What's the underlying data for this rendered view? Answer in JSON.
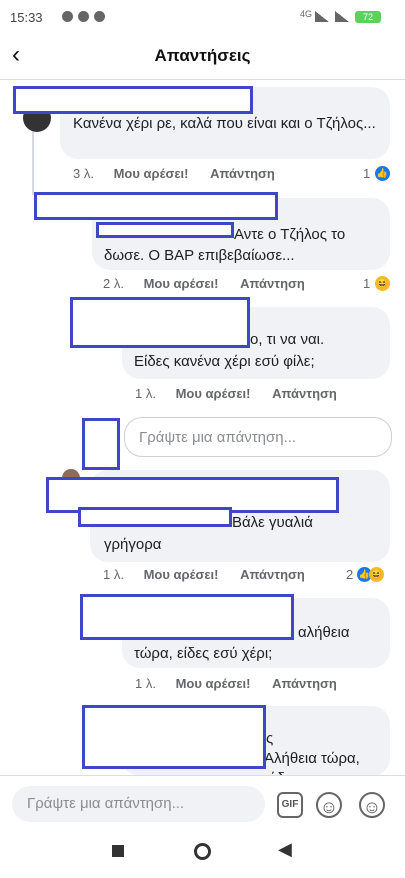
{
  "status": {
    "time": "15:33",
    "signal_text": "4G",
    "battery": "72"
  },
  "header": {
    "title": "Απαντήσεις",
    "back_icon": "back-arrow-icon"
  },
  "comments": [
    {
      "text": "Κανένα χέρι ρε, καλά που είναι και ο Τζήλος...",
      "time": "3 λ.",
      "like": "Μου αρέσει!",
      "reply": "Απάντηση",
      "reactions": "1"
    },
    {
      "text": "Αντε ο Τζήλος το δωσε. Ο ΒΑΡ επιβεβαίωσε...",
      "time": "2 λ.",
      "like": "Μου αρέσει!",
      "reply": "Απάντηση",
      "reactions": "1"
    },
    {
      "text": "ο, τι να ναι.",
      "text2": "Είδες κανένα χέρι εσύ φίλε;",
      "time": "1 λ.",
      "like": "Μου αρέσει!",
      "reply": "Απάντηση"
    },
    {
      "text": "Βάλε γυαλιά",
      "text2": "γρήγορα",
      "time": "1 λ.",
      "like": "Μου αρέσει!",
      "reply": "Απάντηση",
      "reactions": "2"
    },
    {
      "text": "αλήθεια",
      "text2": "τώρα, είδες εσύ χέρι;",
      "time": "1 λ.",
      "like": "Μου αρέσει!",
      "reply": "Απάντηση"
    },
    {
      "text": "ς",
      "text2": "Αλήθεια τώρα,",
      "text3": "εύδ"
    }
  ],
  "inline_reply": {
    "placeholder": "Γράψτε μια απάντηση..."
  },
  "bottom": {
    "placeholder": "Γράψτε μια απάντηση...",
    "gif_label": "GIF"
  },
  "accent": "#1877f2",
  "redaction_color": "#3f47c9"
}
